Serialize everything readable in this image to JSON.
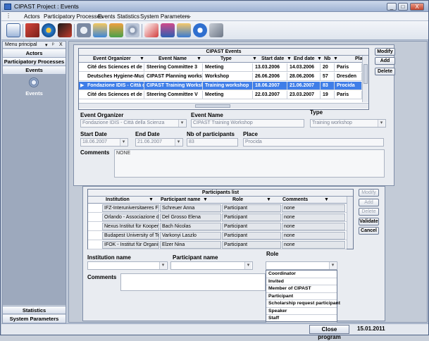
{
  "window": {
    "title": "CIPAST Project : Events",
    "min": "_",
    "max": "□",
    "close": "X"
  },
  "menu": [
    "Actors",
    "Participatory Processes",
    "Events",
    "Statistics",
    "System Parameters",
    "---"
  ],
  "toolbar_icons": [
    "grid-icon",
    "building-icon",
    "globe-icon",
    "pen-icon",
    "mail-icon",
    "users-icon",
    "chart-icon",
    "gear-icon",
    "report-icon",
    "briefcase-icon",
    "contacts-icon",
    "info-icon",
    "tools-icon"
  ],
  "left": {
    "title": "Menu principal",
    "ctrls": [
      "▾",
      "ᵖ",
      "X"
    ],
    "nav_top": [
      "Actors",
      "Participatory Processes",
      "Events"
    ],
    "events_label": "Events",
    "nav_bottom": [
      "Statistics",
      "System Parameters"
    ]
  },
  "events": {
    "title": "CIPAST Events",
    "columns": [
      "Event Organizer",
      "Event Name",
      "Type",
      "Start date",
      "End date",
      "Nb",
      "Pla"
    ],
    "rows": [
      [
        "Cité des Sciences et de l'I",
        "Steering Committee 3",
        "Meeting",
        "13.03.2006",
        "14.03.2006",
        "20",
        "Paris"
      ],
      [
        "Deutsches Hygiene-Muse",
        "CIPAST Planning worksho",
        "Workshop",
        "26.06.2006",
        "28.06.2006",
        "57",
        "Dresden"
      ],
      [
        "Fondazione IDIS - Città d",
        "CIPAST Training Worksho",
        "Training workshop",
        "18.06.2007",
        "21.06.2007",
        "83",
        "Procida"
      ],
      [
        "Cité des Sciences et de l'I",
        "Steering Committee V",
        "Meeting",
        "22.03.2007",
        "23.03.2007",
        "19",
        "Paris"
      ]
    ],
    "selected_marker": "▶",
    "buttons": {
      "modify": "Modify",
      "add": "Add",
      "delete": "Delete"
    }
  },
  "details": {
    "organizer_label": "Event Organizer",
    "organizer_value": "Fondazione IDIS - Città della Scienza",
    "name_label": "Event Name",
    "name_value": "CIPAST Training Workshop",
    "type_label": "Type",
    "type_value": "Training workshop",
    "start_label": "Start Date",
    "start_value": "18.06.2007",
    "end_label": "End Date",
    "end_value": "21.06.2007",
    "nb_label": "Nb of participants",
    "nb_value": "83",
    "place_label": "Place",
    "place_value": "Procida",
    "comments_label": "Comments",
    "comments_value": "NONE"
  },
  "participants": {
    "title": "Participants list",
    "columns": [
      "Institution",
      "Participant name",
      "Role",
      "Comments"
    ],
    "rows": [
      [
        "IFZ-Interuniversitaeres Fo",
        "Schreuer Anna",
        "Participant",
        "none"
      ],
      [
        "Orlando - Associazione di",
        "Del Grosso Elena",
        "Participant",
        "none"
      ],
      [
        "Nexus Institut für Koopera",
        "Bach Nicolas",
        "Participant",
        "none"
      ],
      [
        "Budapest University of Te",
        "Varkonyi Laszlo",
        "Participant",
        "none"
      ],
      [
        "IFOK - Institut für Organis",
        "Elzer Nina",
        "Participant",
        "none"
      ]
    ],
    "buttons": {
      "modify": "Modify",
      "add": "Add",
      "delete": "Delete",
      "validate": "Validate",
      "cancel": "Cancel"
    },
    "institution_label": "Institution name",
    "participant_label": "Participant name",
    "role_label": "Role",
    "comments_label": "Comments",
    "role_options": [
      "Coordinator",
      "Invited",
      "Member of CIPAST",
      "Participant",
      "Scholarship request participant",
      "Speaker",
      "Staff"
    ]
  },
  "status": {
    "close_label": "Close program",
    "date": "15.01.2011"
  }
}
